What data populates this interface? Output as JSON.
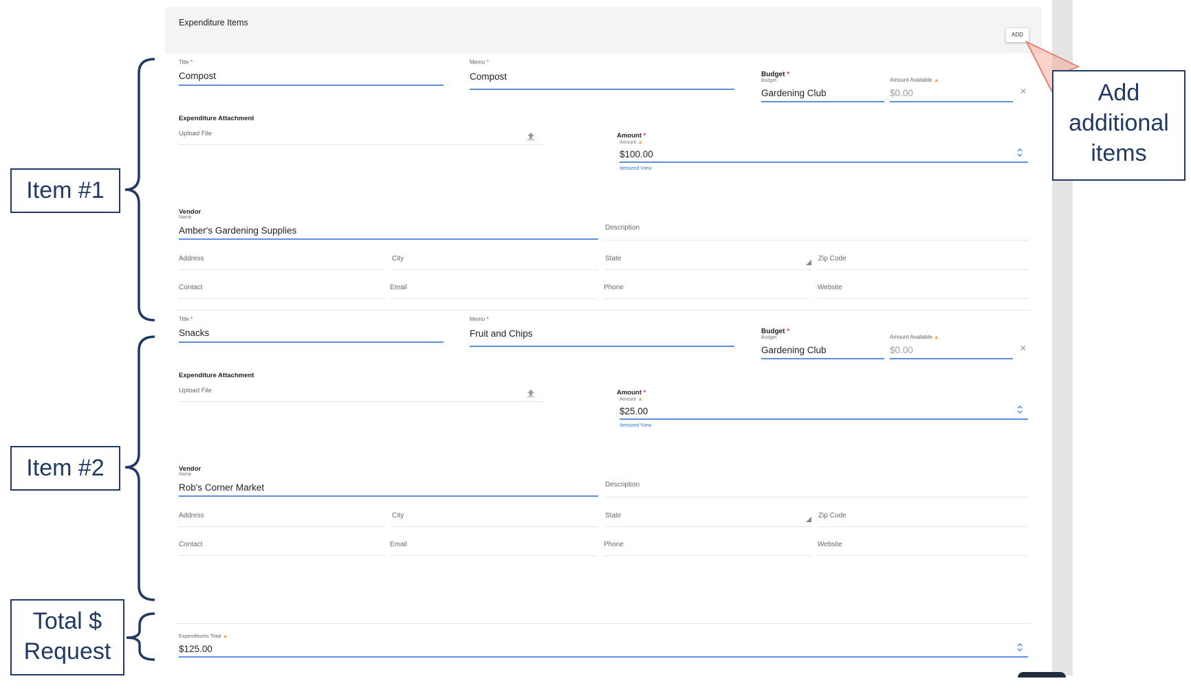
{
  "panel": {
    "title": "Expenditure Items",
    "add_label": "ADD"
  },
  "items": [
    {
      "title_label": "Title",
      "title_value": "Compost",
      "memo_label": "Memo",
      "memo_value": "Compost",
      "budget_label": "Budget",
      "budget_sub": "Budget",
      "budget_value": "Gardening Club",
      "available_label": "Amount Available",
      "available_value": "$0.00",
      "attachment_label": "Expenditure Attachment",
      "upload_label": "Upload File",
      "amount_label": "Amount",
      "amount_sub": "Amount",
      "amount_value": "$100.00",
      "itemized_link": "Itemized View",
      "vendor_label": "Vendor",
      "vendor_sub": "Name",
      "vendor_value": "Amber's Gardening Supplies",
      "description": "Description",
      "address": "Address",
      "city": "City",
      "state": "State",
      "zip": "Zip Code",
      "contact": "Contact",
      "email": "Email",
      "phone": "Phone",
      "website": "Website"
    },
    {
      "title_label": "Title",
      "title_value": "Snacks",
      "memo_label": "Memo",
      "memo_value": "Fruit and Chips",
      "budget_label": "Budget",
      "budget_sub": "Budget",
      "budget_value": "Gardening Club",
      "available_label": "Amount Available",
      "available_value": "$0.00",
      "attachment_label": "Expenditure Attachment",
      "upload_label": "Upload File",
      "amount_label": "Amount",
      "amount_sub": "Amount",
      "amount_value": "$25.00",
      "itemized_link": "Itemized View",
      "vendor_label": "Vendor",
      "vendor_sub": "Name",
      "vendor_value": "Rob's Corner Market",
      "description": "Description",
      "address": "Address",
      "city": "City",
      "state": "State",
      "zip": "Zip Code",
      "contact": "Contact",
      "email": "Email",
      "phone": "Phone",
      "website": "Website"
    }
  ],
  "total": {
    "label": "Expenditures Total",
    "value": "$125.00"
  },
  "annotations": {
    "item1": "Item #1",
    "item2": "Item #2",
    "total_line1": "Total $",
    "total_line2": "Request",
    "add_line1": "Add",
    "add_line2": "additional",
    "add_line3": "items"
  },
  "colors": {
    "accent": "#5b8fd9",
    "annotation": "#1f3864",
    "arrow": "#f4a08c",
    "required": "#e53935",
    "warning": "#f5a623"
  }
}
